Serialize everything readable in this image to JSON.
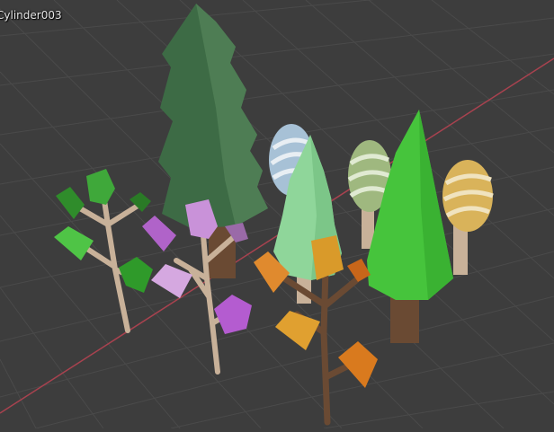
{
  "viewport": {
    "active_object_label": "Cylinder003",
    "colors": {
      "background": "#3d3d3d",
      "grid_line": "#4a4a4a",
      "x_axis": "#a8424f",
      "pine_dark": "#3d6b45",
      "pine_light_green": "#8fd69a",
      "pine_bright_green": "#46c43c",
      "egg_blue": "#a7c1d6",
      "egg_green": "#9fb87f",
      "egg_yellow": "#d9b35a",
      "branch_green_leaves": "#3fa83a",
      "branch_purple_leaves": "#c992d9",
      "branch_orange_leaves": "#d98a2a",
      "trunk_light": "#c8b199",
      "trunk_dark": "#6a4a33"
    }
  }
}
